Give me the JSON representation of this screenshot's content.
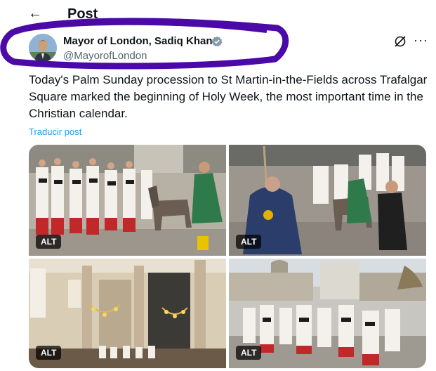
{
  "header": {
    "title": "Post",
    "back_icon": "arrow-left-icon"
  },
  "author": {
    "display_name": "Mayor of London, Sadiq Khan",
    "handle": "@MayorofLondon",
    "verified_color": "#829aab"
  },
  "post": {
    "text": "Today's Palm Sunday procession to St Martin-in-the-Fields across Trafalgar Square marked the beginning of Holy Week, the most important time in the Christian calendar.",
    "translate_label": "Traducir post"
  },
  "media": [
    {
      "alt_label": "ALT"
    },
    {
      "alt_label": "ALT"
    },
    {
      "alt_label": "ALT"
    },
    {
      "alt_label": "ALT"
    }
  ],
  "colors": {
    "accent": "#1d9bf0",
    "annotation": "#4b0aa8",
    "text": "#0f1419",
    "muted": "#536471"
  }
}
